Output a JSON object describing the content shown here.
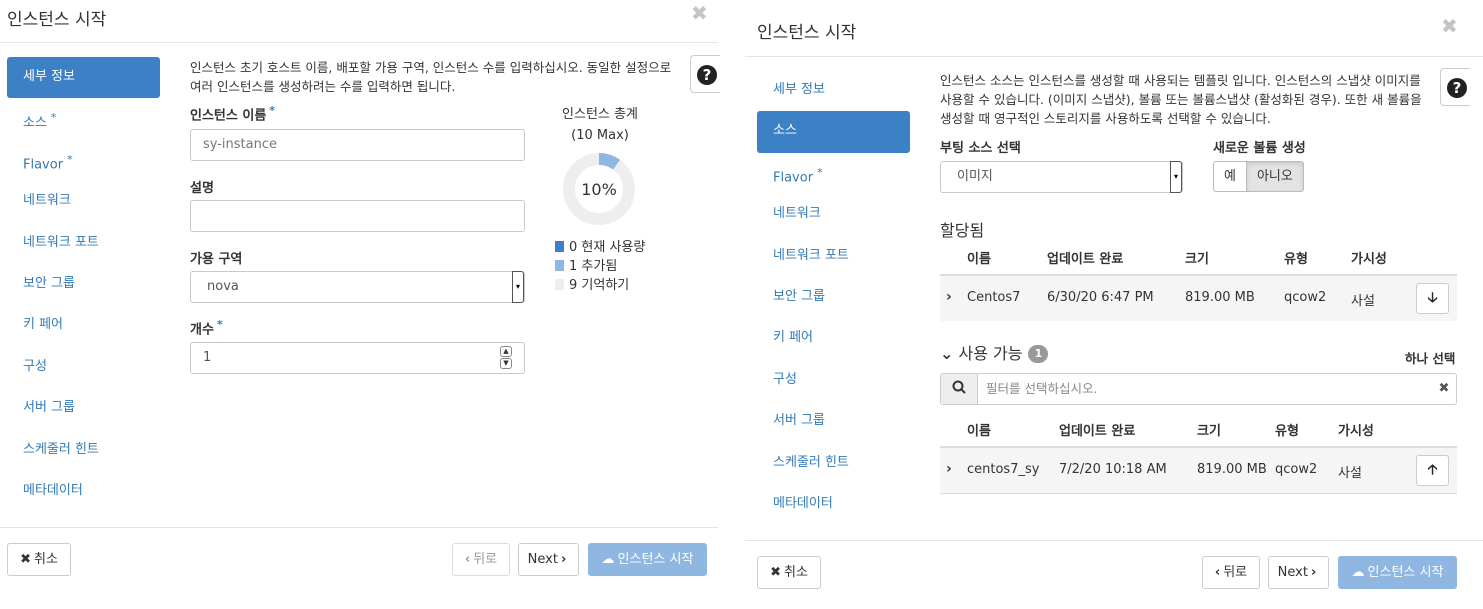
{
  "left": {
    "title": "인스턴스 시작",
    "close_glyph": "✖",
    "nav": [
      {
        "label": "세부 정보",
        "required": false,
        "active": true
      },
      {
        "label": "소스",
        "required": true,
        "active": false
      },
      {
        "label": "Flavor",
        "required": true,
        "active": false
      },
      {
        "label": "네트워크",
        "required": false,
        "active": false
      },
      {
        "label": "네트워크 포트",
        "required": false,
        "active": false
      },
      {
        "label": "보안 그룹",
        "required": false,
        "active": false
      },
      {
        "label": "키 페어",
        "required": false,
        "active": false
      },
      {
        "label": "구성",
        "required": false,
        "active": false
      },
      {
        "label": "서버 그룹",
        "required": false,
        "active": false
      },
      {
        "label": "스케줄러 힌트",
        "required": false,
        "active": false
      },
      {
        "label": "메타데이터",
        "required": false,
        "active": false
      }
    ],
    "required_mark": "*",
    "description_line1": "인스턴스 초기 호스트 이름, 배포할 가용 구역, 인스턴스 수를 입력하십시오. 동일한 설정으로",
    "description_line2": "여러 인스턴스를 생성하려는 수를 입력하면 됩니다.",
    "help_glyph": "?",
    "fields": {
      "name_label": "인스턴스 이름",
      "name_placeholder": "sy-instance",
      "description_label": "설명",
      "description_value": "",
      "az_label": "가용 구역",
      "az_value": "nova",
      "count_label": "개수",
      "count_value": "1"
    },
    "chart_data": {
      "type": "pie",
      "title": "인스턴스 총계",
      "subtitle": "(10 Max)",
      "center_label": "10%",
      "series": [
        {
          "name": "현재 사용량",
          "value": 0,
          "color": "#3c80c6"
        },
        {
          "name": "추가됨",
          "value": 1,
          "color": "#8fb7e1"
        },
        {
          "name": "기억하기",
          "value": 9,
          "color": "#eeeeee"
        }
      ]
    },
    "buttons": {
      "cancel": "취소",
      "back": "뒤로",
      "next": "Next",
      "launch": "인스턴스 시작"
    }
  },
  "right": {
    "title": "인스턴스 시작",
    "close_glyph": "✖",
    "nav": [
      {
        "label": "세부 정보",
        "required": false,
        "active": false
      },
      {
        "label": "소스",
        "required": false,
        "active": true
      },
      {
        "label": "Flavor",
        "required": true,
        "active": false
      },
      {
        "label": "네트워크",
        "required": false,
        "active": false
      },
      {
        "label": "네트워크 포트",
        "required": false,
        "active": false
      },
      {
        "label": "보안 그룹",
        "required": false,
        "active": false
      },
      {
        "label": "키 페어",
        "required": false,
        "active": false
      },
      {
        "label": "구성",
        "required": false,
        "active": false
      },
      {
        "label": "서버 그룹",
        "required": false,
        "active": false
      },
      {
        "label": "스케줄러 힌트",
        "required": false,
        "active": false
      },
      {
        "label": "메타데이터",
        "required": false,
        "active": false
      }
    ],
    "required_mark": "*",
    "description_line1": "인스턴스 소스는 인스턴스를 생성할 때 사용되는 템플릿 입니다. 인스턴스의 스냅샷 이미지를",
    "description_line2": "사용할 수 있습니다. (이미지 스냅샷), 볼륨 또는 볼륨스냅샷 (활성화된 경우). 또한 새 볼륨을",
    "description_line3": "생성할 때 영구적인 스토리지를 사용하도록 선택할 수 있습니다.",
    "help_glyph": "?",
    "boot_source_label": "부팅 소스 선택",
    "boot_source_value": "이미지",
    "new_volume_label": "새로운 볼륨 생성",
    "new_volume_yes": "예",
    "new_volume_no": "아니오",
    "allocated_title": "할당됨",
    "allocated_headers": [
      "이름",
      "업데이트 완료",
      "크기",
      "유형",
      "가시성"
    ],
    "allocated_rows": [
      {
        "name": "Centos7",
        "updated": "6/30/20 6:47 PM",
        "size": "819.00 MB",
        "type": "qcow2",
        "visibility": "사설"
      }
    ],
    "available_title": "사용 가능",
    "available_count": "1",
    "select_one": "하나 선택",
    "filter_placeholder": "필터를 선택하십시오.",
    "available_headers": [
      "이름",
      "업데이트 완료",
      "크기",
      "유형",
      "가시성"
    ],
    "available_rows": [
      {
        "name": "centos7_sy",
        "updated": "7/2/20 10:18 AM",
        "size": "819.00 MB",
        "type": "qcow2",
        "visibility": "사설"
      }
    ],
    "buttons": {
      "cancel": "취소",
      "back": "뒤로",
      "next": "Next",
      "launch": "인스턴스 시작"
    }
  }
}
